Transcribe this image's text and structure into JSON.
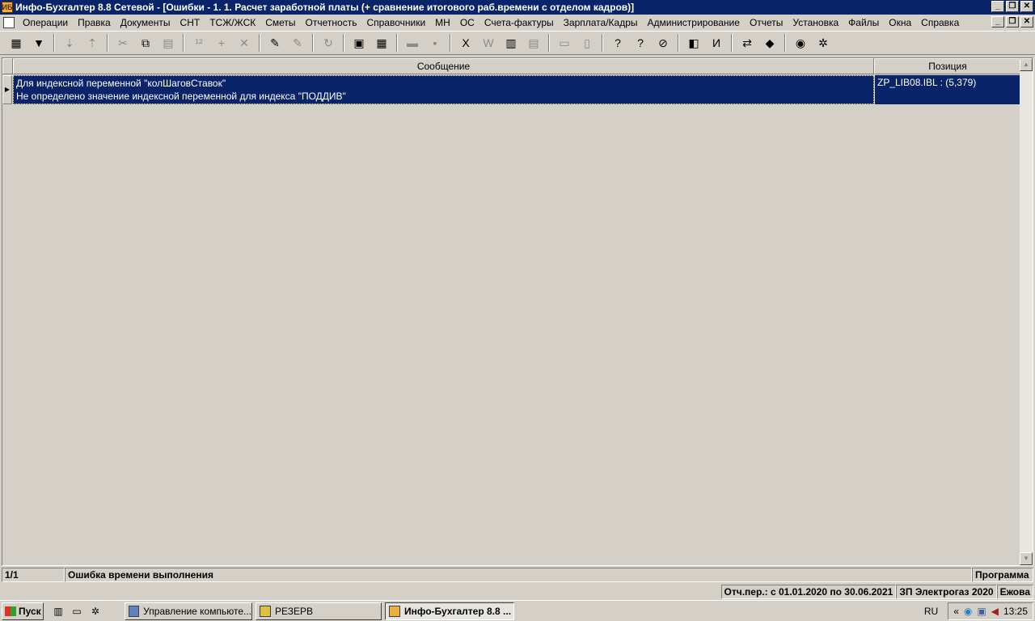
{
  "window": {
    "title": "Инфо-Бухгалтер 8.8 Сетевой - [Ошибки - 1. 1. Расчет заработной платы (+ сравнение итогового раб.времени с отделом кадров)]",
    "app_icon": "ИБ"
  },
  "winbtns": {
    "minimize": "_",
    "restore": "❐",
    "close": "✕"
  },
  "menu": [
    "Операции",
    "Правка",
    "Документы",
    "СНТ",
    "ТСЖ/ЖСК",
    "Сметы",
    "Отчетность",
    "Справочники",
    "МН",
    "ОС",
    "Счета-фактуры",
    "Зарплата/Кадры",
    "Администрирование",
    "Отчеты",
    "Установка",
    "Файлы",
    "Окна",
    "Справка"
  ],
  "toolbar": [
    {
      "icon": "table-view-icon",
      "glyph": "▦",
      "dim": false
    },
    {
      "icon": "filter-icon",
      "glyph": "▼",
      "dim": false
    },
    {
      "sep": true
    },
    {
      "icon": "sort-asc-icon",
      "glyph": "⇣",
      "dim": true
    },
    {
      "icon": "sort-desc-icon",
      "glyph": "⇡",
      "dim": true
    },
    {
      "sep": true
    },
    {
      "icon": "cut-icon",
      "glyph": "✂",
      "dim": true
    },
    {
      "icon": "copy-icon",
      "glyph": "⧉",
      "dim": false
    },
    {
      "icon": "paste-icon",
      "glyph": "▤",
      "dim": true
    },
    {
      "sep": true
    },
    {
      "icon": "abc-icon",
      "glyph": "¹²",
      "dim": true
    },
    {
      "icon": "add-icon",
      "glyph": "+",
      "dim": true
    },
    {
      "icon": "delete-icon",
      "glyph": "✕",
      "dim": true
    },
    {
      "sep": true
    },
    {
      "icon": "mark-icon",
      "glyph": "✎",
      "dim": false
    },
    {
      "icon": "unmark-icon",
      "glyph": "✎",
      "dim": true
    },
    {
      "sep": true
    },
    {
      "icon": "refresh-icon",
      "glyph": "↻",
      "dim": true
    },
    {
      "sep": true
    },
    {
      "icon": "calendar-icon",
      "glyph": "▣",
      "dim": false
    },
    {
      "icon": "calculator-icon",
      "glyph": "▦",
      "dim": false
    },
    {
      "sep": true
    },
    {
      "icon": "open-folder-icon",
      "glyph": "▬",
      "dim": true
    },
    {
      "icon": "save-icon",
      "glyph": "▪",
      "dim": true
    },
    {
      "sep": true
    },
    {
      "icon": "excel-icon",
      "glyph": "X",
      "dim": false
    },
    {
      "icon": "word-icon",
      "glyph": "W",
      "dim": true
    },
    {
      "icon": "export-icon",
      "glyph": "▥",
      "dim": false
    },
    {
      "icon": "import-icon",
      "glyph": "▤",
      "dim": true
    },
    {
      "sep": true
    },
    {
      "icon": "print-icon",
      "glyph": "▭",
      "dim": true
    },
    {
      "icon": "preview-icon",
      "glyph": "▯",
      "dim": true
    },
    {
      "sep": true
    },
    {
      "icon": "help-icon",
      "glyph": "?",
      "dim": false
    },
    {
      "icon": "context-help-icon",
      "glyph": "?",
      "dim": false
    },
    {
      "icon": "compass-icon",
      "glyph": "⊘",
      "dim": false
    },
    {
      "sep": true
    },
    {
      "icon": "program-icon",
      "glyph": "◧",
      "dim": false
    },
    {
      "icon": "ib10-icon",
      "glyph": "И",
      "dim": false
    },
    {
      "sep": true
    },
    {
      "icon": "teamviewer-icon",
      "glyph": "⇄",
      "dim": false
    },
    {
      "icon": "support-icon",
      "glyph": "◆",
      "dim": false
    },
    {
      "sep": true
    },
    {
      "icon": "web-icon",
      "glyph": "◉",
      "dim": false
    },
    {
      "icon": "tools-icon",
      "glyph": "✲",
      "dim": false
    }
  ],
  "grid": {
    "columns": {
      "message": "Сообщение",
      "position": "Позиция"
    },
    "rows": [
      {
        "line1": "Для индексной переменной \"колШаговСтавок\"",
        "line2": "Не определено значение индексной переменной для индекса \"ПОДДИВ\"",
        "position": "ZP_LIB08.IBL : (5,379)"
      }
    ]
  },
  "status1": {
    "counter": "1/1",
    "message": "Ошибка времени выполнения",
    "program": "Программа"
  },
  "status2": {
    "period": "Отч.пер.: с 01.01.2020 по 30.06.2021",
    "base": "ЗП Электрогаз 2020",
    "user": "Ежова"
  },
  "taskbar": {
    "start": "Пуск",
    "tasks": [
      {
        "label": "Управление компьюте...",
        "active": false
      },
      {
        "label": "РЕЗЕРВ",
        "active": false
      },
      {
        "label": "Инфо-Бухгалтер 8.8 ...",
        "active": true
      }
    ],
    "lang": "RU",
    "tray_expand": "«",
    "clock": "13:25"
  },
  "colors": {
    "titlebar": "#0a246a",
    "face": "#d4d0c8",
    "selection": "#0a246a"
  }
}
